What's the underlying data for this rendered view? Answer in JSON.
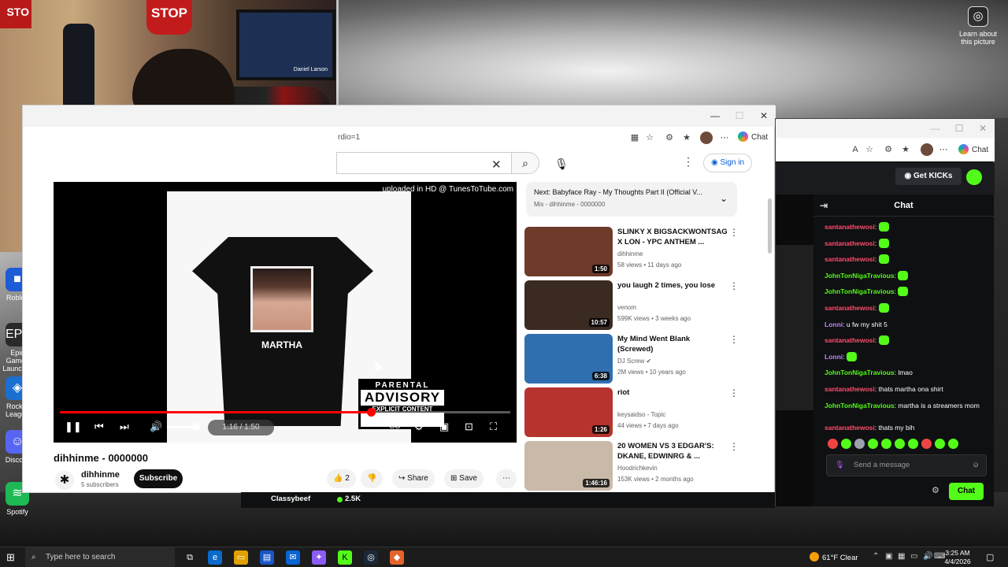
{
  "desktop": {
    "learn_label": "Learn about this picture",
    "icons": [
      {
        "label": "Roblox",
        "name": "roblox-desktop-icon",
        "color": "#1e5bd6",
        "glyph": "■"
      },
      {
        "label": "Epic Games Launcher",
        "name": "epic-games-desktop-icon",
        "color": "#2a2a2a",
        "glyph": "EPIC"
      },
      {
        "label": "Rocket League",
        "name": "rocket-league-desktop-icon",
        "color": "#1b6fd1",
        "glyph": "◈"
      },
      {
        "label": "Discord",
        "name": "discord-desktop-icon",
        "color": "#5865f2",
        "glyph": "☺"
      },
      {
        "label": "Spotify",
        "name": "spotify-desktop-icon",
        "color": "#1db954",
        "glyph": "≋"
      }
    ]
  },
  "webcam": {
    "stop_sign": "STOP",
    "tv_caption": "Daniel Larson"
  },
  "youtube": {
    "address_fragment": "rdio=1",
    "copilot_label": "Chat",
    "signin_label": "Sign in",
    "player": {
      "watermark": "uploaded in HD @ TunesToTube.com",
      "shirt_text": "MARTHA",
      "advisory": [
        "PARENTAL",
        "ADVISORY",
        "EXPLICIT CONTENT"
      ],
      "time": "1:16 / 1:50",
      "progress": 0.69,
      "volume": 0.8
    },
    "video_title": "dihhinme - 0000000",
    "channel": {
      "name": "dihhinme",
      "subs": "5 subscribers",
      "subscribe_label": "Subscribe"
    },
    "actions": {
      "likes": "2",
      "share_label": "Share",
      "save_label": "Save"
    },
    "up_next": {
      "title": "Next: Babyface Ray - My Thoughts Part II (Official V...",
      "sub": "Mix - dihhinme - 0000000"
    },
    "recommendations": [
      {
        "title": "SLINKY X BIGSACKWONTSAG X LON - YPC ANTHEM ...",
        "channel": "dihhinme",
        "meta": "58 views • 11 days ago",
        "duration": "1:50",
        "color": "#6e3a2a",
        "verified": false
      },
      {
        "title": "you laugh 2 times, you lose",
        "channel": "venom",
        "meta": "599K views • 3 weeks ago",
        "duration": "10:57",
        "color": "#3b2a22",
        "verified": false
      },
      {
        "title": "My Mind Went Blank (Screwed)",
        "channel": "DJ Screw",
        "meta": "2M views • 10 years ago",
        "duration": "6:38",
        "color": "#2f6fb0",
        "verified": true
      },
      {
        "title": "riot",
        "channel": "keysaidso - Topic",
        "meta": "44 views • 7 days ago",
        "duration": "1:26",
        "color": "#b7342e",
        "verified": false
      },
      {
        "title": "20 WOMEN VS 3 EDGAR'S: DKANE, EDWINRG & ...",
        "channel": "Hoodrichkevin",
        "meta": "153K views • 2 months ago",
        "duration": "1:46:16",
        "color": "#c9b9a8",
        "verified": false
      }
    ]
  },
  "kick": {
    "copilot_label": "Chat",
    "get_kicks_label": "Get KICKs",
    "chat_title": "Chat",
    "messages": [
      {
        "user": "santanathewosi",
        "text": "",
        "color": "#ff4d6d",
        "emote": true
      },
      {
        "user": "santanathewosi",
        "text": "",
        "color": "#ff4d6d",
        "emote": true
      },
      {
        "user": "santanathewosi",
        "text": "",
        "color": "#ff4d6d",
        "emote": true
      },
      {
        "user": "JohnTonNigaTravious",
        "text": "",
        "color": "#53fc18",
        "emote": true
      },
      {
        "user": "JohnTonNigaTravious",
        "text": "",
        "color": "#53fc18",
        "emote": true
      },
      {
        "user": "santanathewosi",
        "text": "",
        "color": "#ff4d6d",
        "emote": true
      },
      {
        "user": "Lonni",
        "text": "u fw my shit 5",
        "color": "#c084fc",
        "emote": false
      },
      {
        "user": "santanathewosi",
        "text": "",
        "color": "#ff4d6d",
        "emote": true
      },
      {
        "user": "Lonni",
        "text": "",
        "color": "#c084fc",
        "emote": true
      },
      {
        "user": "JohnTonNigaTravious",
        "text": "lmao",
        "color": "#53fc18",
        "emote": false
      },
      {
        "user": "santanathewosi",
        "text": "thats martha ona shirt",
        "color": "#ff4d6d",
        "emote": false
      },
      {
        "user": "JohnTonNigaTravious",
        "text": "martha is a streamers mom",
        "color": "#53fc18",
        "emote": false
      },
      {
        "user": "santanathewosi",
        "text": "thats my bih",
        "color": "#ff4d6d",
        "emote": false
      }
    ],
    "send_placeholder": "Send a message",
    "chat_button": "Chat",
    "bottom_user": "Classybeef",
    "bottom_count": "2.5K"
  },
  "taskbar": {
    "search_placeholder": "Type here to search",
    "weather": "61°F  Clear",
    "time": "3:25 AM",
    "date": "4/4/2026"
  }
}
